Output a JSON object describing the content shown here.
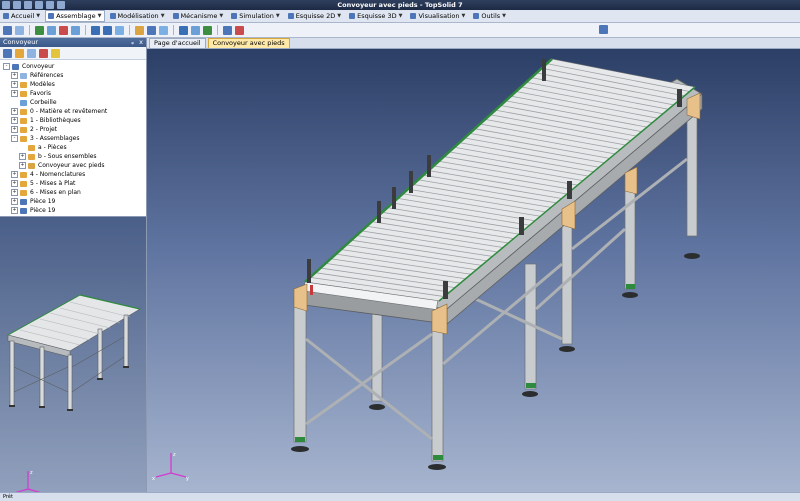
{
  "window": {
    "title": "Convoyeur avec pieds - TopSolid 7"
  },
  "menubar": {
    "tabs": [
      {
        "label": "Accueil",
        "active": false
      },
      {
        "label": "Assemblage",
        "active": true
      },
      {
        "label": "Modélisation",
        "active": false
      },
      {
        "label": "Mécanisme",
        "active": false
      },
      {
        "label": "Simulation",
        "active": false
      },
      {
        "label": "Esquisse 2D",
        "active": false
      },
      {
        "label": "Esquisse 3D",
        "active": false
      },
      {
        "label": "Visualisation",
        "active": false
      },
      {
        "label": "Outils",
        "active": false
      }
    ]
  },
  "panel": {
    "title": "Convoyeur",
    "pin": "ᵩ",
    "close": "x",
    "tree": [
      {
        "label": "Convoyeur",
        "level": 0,
        "icon": "project-icon",
        "expander": "-"
      },
      {
        "label": "Références",
        "level": 1,
        "icon": "references-icon",
        "expander": "+"
      },
      {
        "label": "Modèles",
        "level": 1,
        "icon": "models-icon",
        "expander": "+"
      },
      {
        "label": "Favoris",
        "level": 1,
        "icon": "favorites-icon",
        "expander": "+"
      },
      {
        "label": "Corbeille",
        "level": 1,
        "icon": "trash-icon",
        "expander": ""
      },
      {
        "label": "0 - Matière et revêtement",
        "level": 1,
        "icon": "folder-icon",
        "expander": "+"
      },
      {
        "label": "1 - Bibliothèques",
        "level": 1,
        "icon": "folder-icon",
        "expander": "+"
      },
      {
        "label": "2 - Projet",
        "level": 1,
        "icon": "folder-icon",
        "expander": "+"
      },
      {
        "label": "3 - Assemblages",
        "level": 1,
        "icon": "folder-icon",
        "expander": "-"
      },
      {
        "label": "a - Pièces",
        "level": 2,
        "icon": "folder-icon",
        "expander": ""
      },
      {
        "label": "b - Sous ensembles",
        "level": 2,
        "icon": "folder-icon",
        "expander": "+"
      },
      {
        "label": "Convoyeur avec pieds",
        "level": 2,
        "icon": "assembly-icon",
        "expander": "+"
      },
      {
        "label": "4 - Nomenclatures",
        "level": 1,
        "icon": "folder-icon",
        "expander": "+"
      },
      {
        "label": "5 - Mises à Plat",
        "level": 1,
        "icon": "folder-icon",
        "expander": "+"
      },
      {
        "label": "6 - Mises en plan",
        "level": 1,
        "icon": "folder-icon",
        "expander": "+"
      },
      {
        "label": "Pièce 19",
        "level": 1,
        "icon": "part-icon",
        "expander": "+"
      },
      {
        "label": "Pièce 19",
        "level": 1,
        "icon": "part-icon",
        "expander": "+"
      }
    ]
  },
  "tabs": [
    {
      "label": "Page d'accueil",
      "active": false
    },
    {
      "label": "Convoyeur avec pieds",
      "active": true
    }
  ],
  "triad": {
    "x": "x",
    "y": "y",
    "z": "z"
  },
  "status": {
    "left": "Prêt"
  },
  "colors": {
    "accent": "#ffe9a8",
    "frame": "#c9cccf",
    "brackets": "#e8c08a",
    "belt_edge": "#2e8b3e"
  }
}
